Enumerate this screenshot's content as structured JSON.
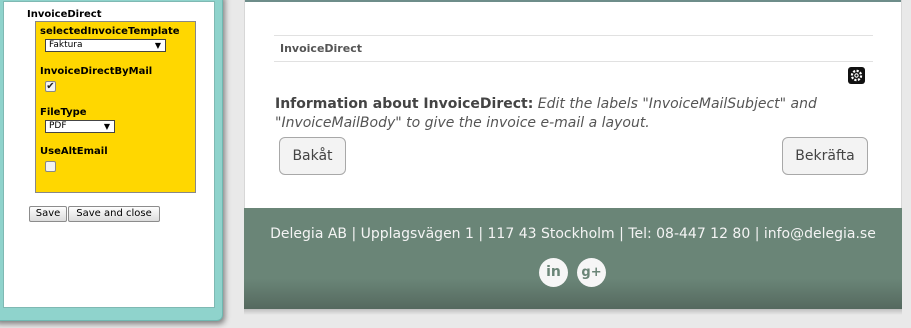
{
  "editor": {
    "title": "InvoiceDirect",
    "props": {
      "selected_template_label": "selectedInvoiceTemplate",
      "selected_template_value": "Faktura",
      "invoice_by_mail_label": "InvoiceDirectByMail",
      "invoice_by_mail_checked": true,
      "file_type_label": "FileType",
      "file_type_value": "PDF",
      "use_alt_email_label": "UseAltEmail",
      "use_alt_email_checked": false
    },
    "buttons": {
      "save": "Save",
      "save_close": "Save and close"
    },
    "colors": {
      "window_border": "#8fd3cc",
      "props_background": "#ffd700"
    }
  },
  "module": {
    "header": "InvoiceDirect",
    "info_label": "Information about InvoiceDirect:",
    "info_body": "Edit the labels \"InvoiceMailSubject\" and \"InvoiceMailBody\" to give the invoice e-mail a layout.",
    "back_button": "Bakåt",
    "confirm_button": "Bekräfta",
    "settings_icon": "gear-icon"
  },
  "footer": {
    "contact": "Delegia AB | Upplagsvägen 1 | 117 43 Stockholm | Tel: 08-447 12 80 | info@delegia.se",
    "linkedin": "in",
    "googleplus": "g+",
    "color": "#6a8577"
  }
}
